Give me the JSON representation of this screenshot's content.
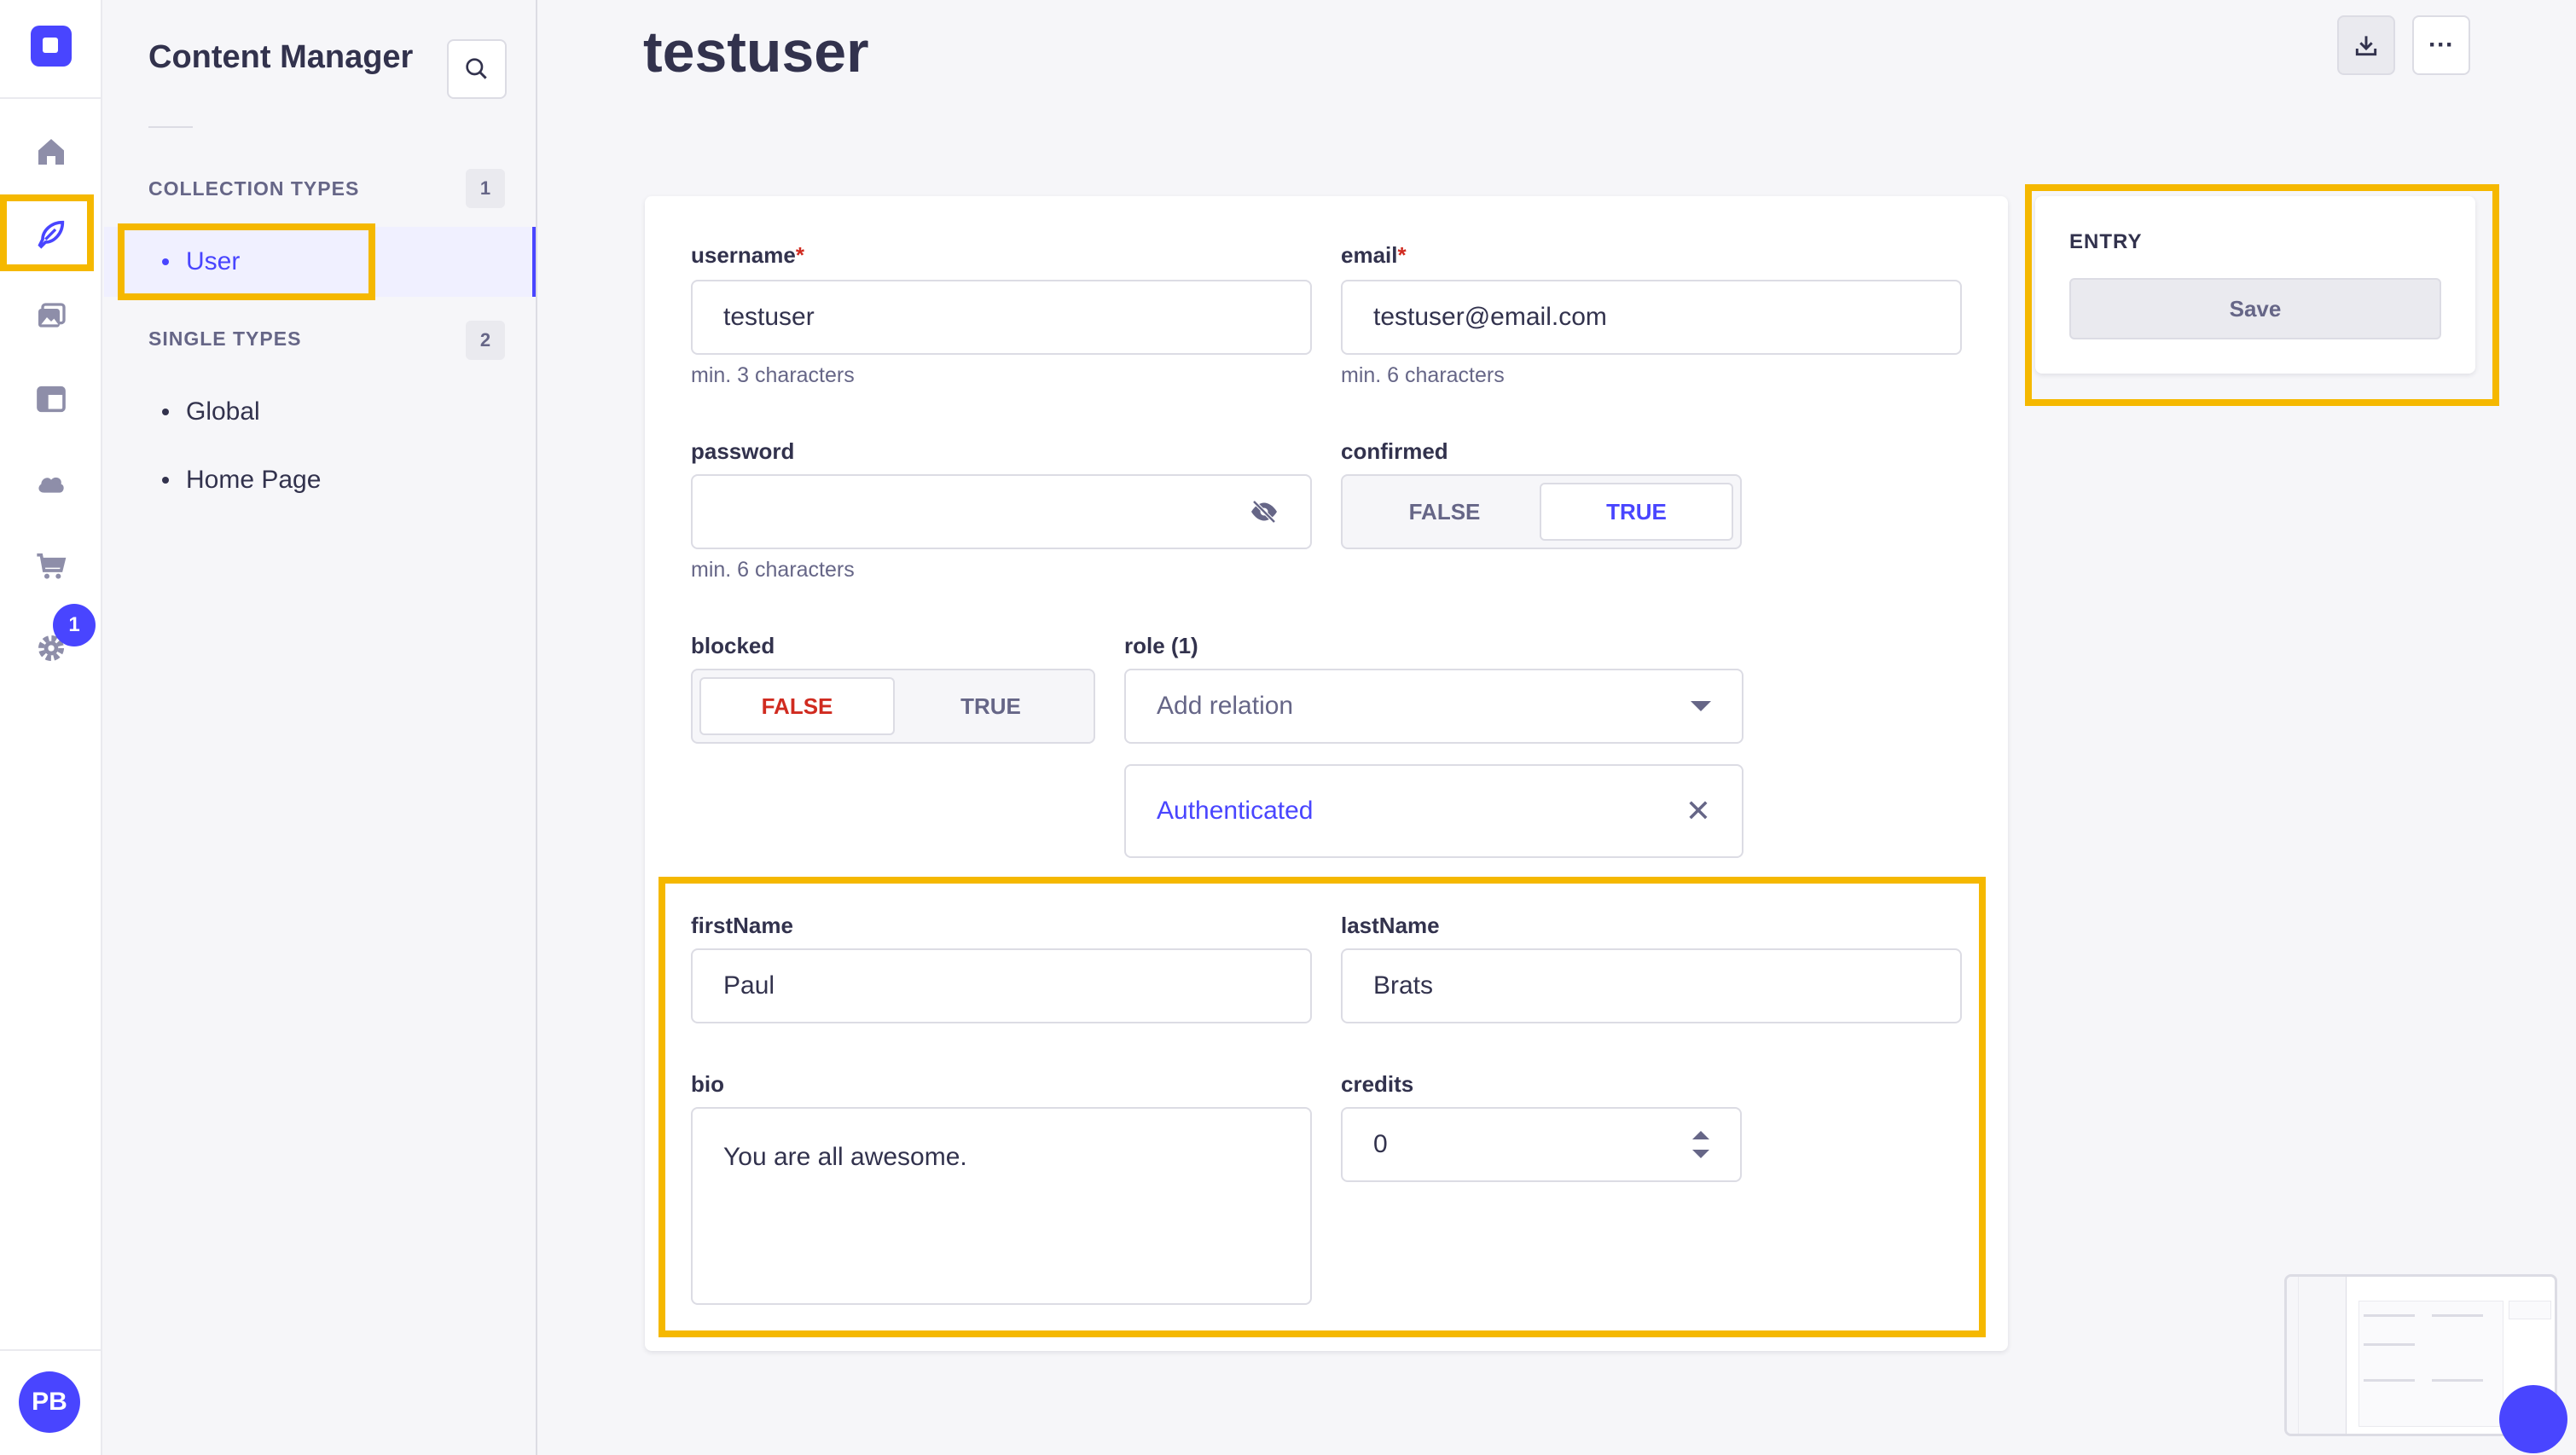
{
  "colors": {
    "accent": "#4945ff",
    "highlight": "#f5b800",
    "danger": "#d02b20",
    "text": "#32324d",
    "muted": "#666687"
  },
  "rail": {
    "logo_icon": "strapi-logo-icon",
    "items": [
      {
        "icon": "home-icon"
      },
      {
        "icon": "feather-icon"
      },
      {
        "icon": "media-library-icon"
      },
      {
        "icon": "layout-icon"
      },
      {
        "icon": "cloud-icon"
      },
      {
        "icon": "cart-icon"
      },
      {
        "icon": "gear-icon"
      }
    ],
    "settings_badge": "1",
    "avatar_initials": "PB"
  },
  "subnav": {
    "title": "Content Manager",
    "search_icon": "search-icon",
    "collection_label": "COLLECTION TYPES",
    "collection_count": "1",
    "collection_items": [
      {
        "label": "User"
      }
    ],
    "single_label": "SINGLE TYPES",
    "single_count": "2",
    "single_items": [
      {
        "label": "Global"
      },
      {
        "label": "Home Page"
      }
    ]
  },
  "header": {
    "title": "testuser",
    "download_icon": "download-icon",
    "more_label": "···"
  },
  "form": {
    "username": {
      "label": "username",
      "required": "*",
      "value": "testuser",
      "hint": "min. 3 characters"
    },
    "email": {
      "label": "email",
      "required": "*",
      "value": "testuser@email.com",
      "hint": "min. 6 characters"
    },
    "password": {
      "label": "password",
      "value": "",
      "hint": "min. 6 characters",
      "icon": "eye-off-icon"
    },
    "confirmed": {
      "label": "confirmed",
      "false_label": "FALSE",
      "true_label": "TRUE",
      "selected": "TRUE"
    },
    "blocked": {
      "label": "blocked",
      "false_label": "FALSE",
      "true_label": "TRUE",
      "selected": "FALSE"
    },
    "role": {
      "label": "role (1)",
      "placeholder": "Add relation",
      "items": [
        {
          "label": "Authenticated"
        }
      ],
      "remove_label": "✕"
    },
    "firstName": {
      "label": "firstName",
      "value": "Paul"
    },
    "lastName": {
      "label": "lastName",
      "value": "Brats"
    },
    "bio": {
      "label": "bio",
      "value": "You are all awesome."
    },
    "credits": {
      "label": "credits",
      "value": "0"
    }
  },
  "entry": {
    "label": "ENTRY",
    "save_label": "Save"
  }
}
